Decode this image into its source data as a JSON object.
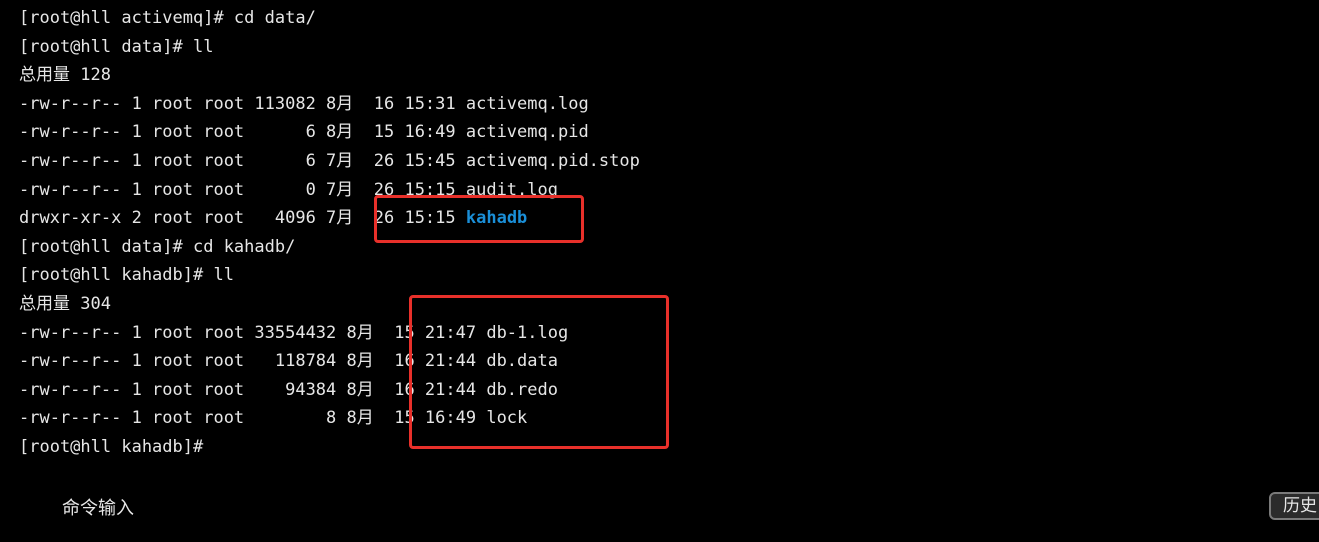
{
  "terminal": {
    "lines": [
      {
        "text": "[root@hll activemq]# cd data/"
      },
      {
        "text": "[root@hll data]# ll"
      },
      {
        "text": "总用量 128"
      },
      {
        "text": "-rw-r--r-- 1 root root 113082 8月  16 15:31 activemq.log"
      },
      {
        "text": "-rw-r--r-- 1 root root      6 8月  15 16:49 activemq.pid"
      },
      {
        "text": "-rw-r--r-- 1 root root      6 7月  26 15:45 activemq.pid.stop"
      },
      {
        "text": "-rw-r--r-- 1 root root      0 7月  26 15:15 audit.log"
      },
      {
        "prefix": "drwxr-xr-x 2 root root   4096 7月  26 15:15 ",
        "dir": "kahadb"
      },
      {
        "text": "[root@hll data]# cd kahadb/"
      },
      {
        "text": "[root@hll kahadb]# ll"
      },
      {
        "text": "总用量 304"
      },
      {
        "text": "-rw-r--r-- 1 root root 33554432 8月  15 21:47 db-1.log"
      },
      {
        "text": "-rw-r--r-- 1 root root   118784 8月  16 21:44 db.data"
      },
      {
        "text": "-rw-r--r-- 1 root root    94384 8月  16 21:44 db.redo"
      },
      {
        "text": "-rw-r--r-- 1 root root        8 8月  15 16:49 lock"
      },
      {
        "text": "[root@hll kahadb]#"
      }
    ]
  },
  "footer": {
    "cmd_input_label": "命令输入",
    "history_button": "历史"
  },
  "colors": {
    "background": "#000000",
    "text": "#e6e6e6",
    "directory": "#1a8fd8",
    "annotation_box": "#e8302a"
  }
}
